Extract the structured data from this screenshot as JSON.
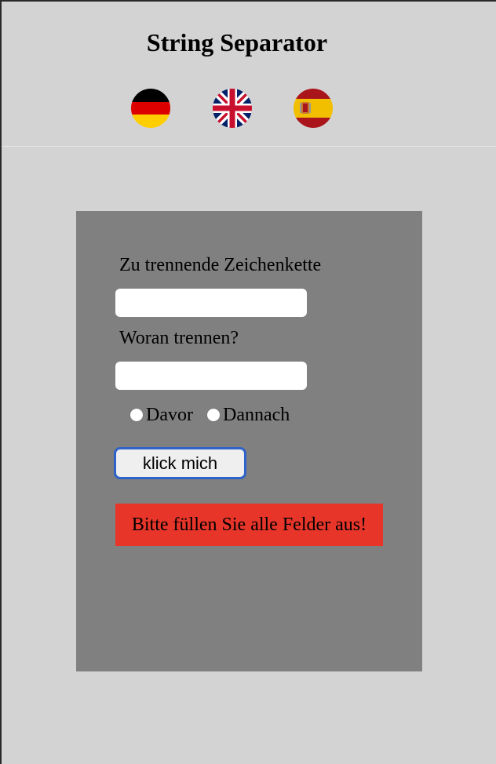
{
  "header": {
    "title": "String Separator",
    "languages": [
      {
        "code": "de",
        "icon": "german-flag-icon"
      },
      {
        "code": "en",
        "icon": "uk-flag-icon"
      },
      {
        "code": "es",
        "icon": "spanish-flag-icon"
      }
    ]
  },
  "form": {
    "string_label": "Zu trennende Zeichenkette",
    "string_value": "",
    "separator_label": "Woran trennen?",
    "separator_value": "",
    "radio_options": [
      {
        "label": "Davor",
        "checked": false
      },
      {
        "label": "Dannach",
        "checked": false
      }
    ],
    "submit_label": "klick mich",
    "error_message": "Bitte füllen Sie alle Felder aus!"
  },
  "colors": {
    "page_background": "#d3d3d3",
    "panel_background": "#808080",
    "error_background": "#e8352a",
    "button_border": "#2f63c9"
  }
}
